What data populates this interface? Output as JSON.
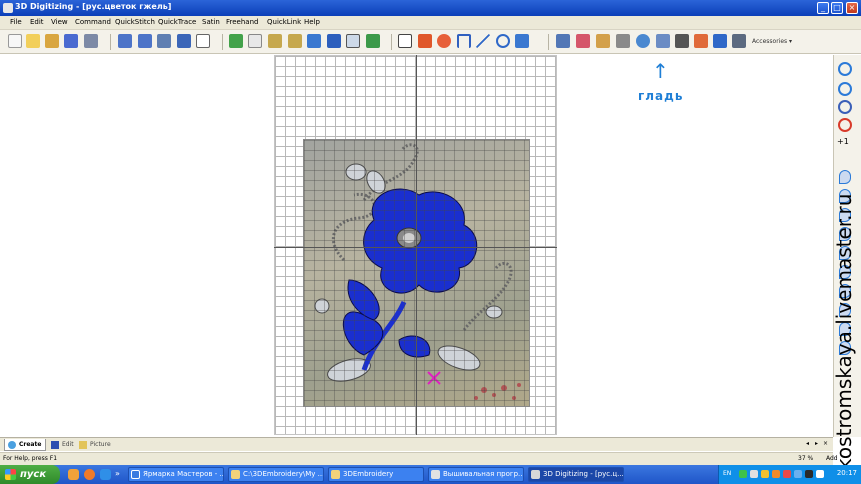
{
  "window": {
    "title": "3D Digitizing - [рус.цветок гжель]"
  },
  "menu": [
    "File",
    "Edit",
    "View",
    "Command",
    "QuickStitch",
    "QuickTrace",
    "Satin",
    "Freehand",
    "QuickLink",
    "Help"
  ],
  "toolbar": {
    "accessories_label": "Accessories",
    "icons": [
      "new-icon",
      "open-icon",
      "cut-icon",
      "save-icon",
      "select-icon",
      "undo-icon",
      "redo-icon",
      "move-icon",
      "delete-icon",
      "view-icon",
      "picture-icon",
      "grid-icon",
      "zoom-in-icon",
      "zoom-out-icon",
      "pan-icon",
      "hand-icon",
      "fill-icon",
      "stitch-icon",
      "node-icon",
      "color-icon",
      "circle-icon",
      "arc-icon",
      "line-icon",
      "rotate-icon",
      "mirror-icon",
      "run-icon",
      "brush-icon",
      "scissors-icon",
      "satin-icon",
      "curve-icon",
      "star-icon",
      "applique-icon",
      "cross-stitch-icon",
      "columns-icon"
    ]
  },
  "annotation": {
    "arrow": "↑",
    "label": "гладь"
  },
  "bottom_tabs": [
    {
      "label": "Create",
      "active": true
    },
    {
      "label": "Edit",
      "active": false
    },
    {
      "label": "Picture",
      "active": false
    }
  ],
  "status": {
    "help_text": "For Help, press F1",
    "zoom": "37 %",
    "mode": "Add"
  },
  "taskbar": {
    "start_label": "пуск",
    "tasks": [
      {
        "label": "Ярмарка Мастеров - ...",
        "active": false
      },
      {
        "label": "C:\\3DEmbroidery\\My ...",
        "active": false
      },
      {
        "label": "3DEmbroidery",
        "active": false
      },
      {
        "label": "Вышивальная прогр...",
        "active": false
      },
      {
        "label": "3D Digitizing - [рус.ц...",
        "active": true
      }
    ],
    "tray_lang": "EN",
    "clock": "20:17"
  },
  "watermark": "kostromskaya.livemaster.ru",
  "colors": {
    "accent": "#1f7fd6",
    "cobalt": "#1a2fd0",
    "titlebar": "#0b3fb8"
  }
}
